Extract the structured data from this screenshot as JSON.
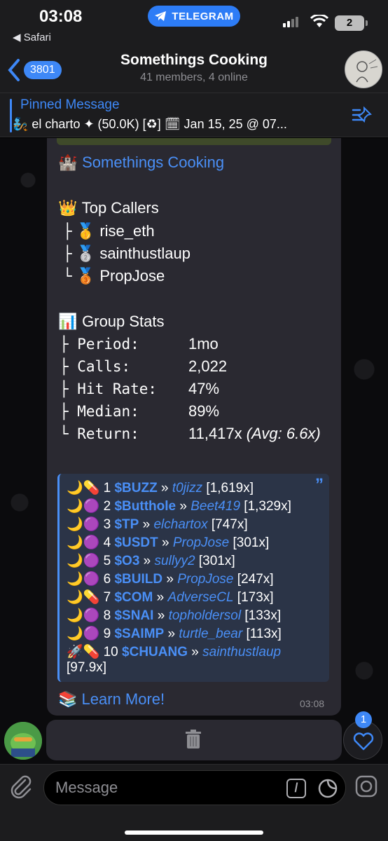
{
  "status_bar": {
    "time": "03:08",
    "back_app": "◀ Safari",
    "pill_label": "TELEGRAM",
    "battery": "2"
  },
  "header": {
    "back_count": "3801",
    "title": "Somethings Cooking",
    "subtitle": "41 members, 4 online"
  },
  "pinned": {
    "label": "Pinned Message",
    "text": "🧞 el charto ✦ (50.0K) [♻] 🗓 Jan 15, 25 @ 07..."
  },
  "message": {
    "group_title": "Somethings Cooking",
    "top_callers_title": "Top Callers",
    "top_callers": [
      {
        "branch": "├",
        "medal": "🥇",
        "name": "rise_eth"
      },
      {
        "branch": "├",
        "medal": "🥈",
        "name": "sainthustlaup"
      },
      {
        "branch": "└",
        "medal": "🥉",
        "name": "PropJose"
      }
    ],
    "stats_title": "Group Stats",
    "stats": [
      {
        "key": "├ Period:",
        "value": "1mo",
        "extra": ""
      },
      {
        "key": "├ Calls:",
        "value": "2,022",
        "extra": ""
      },
      {
        "key": "├ Hit Rate:",
        "value": "47%",
        "extra": ""
      },
      {
        "key": "├ Median:",
        "value": "89%",
        "extra": ""
      },
      {
        "key": "└ Return:",
        "value": "11,417x",
        "extra": "(Avg: 6.6x)"
      }
    ],
    "calls": [
      {
        "icons": "🌙💊",
        "rank": "1",
        "ticker": "$BUZZ",
        "sep": "»",
        "user": "t0jizz",
        "mult": "[1,619x]"
      },
      {
        "icons": "🌙🟣",
        "rank": "2",
        "ticker": "$Butthole",
        "sep": "»",
        "user": "Beet419",
        "mult": "[1,329x]"
      },
      {
        "icons": "🌙🟣",
        "rank": "3",
        "ticker": "$TP",
        "sep": "»",
        "user": "elchartox",
        "mult": "[747x]"
      },
      {
        "icons": "🌙🟣",
        "rank": "4",
        "ticker": "$USDT",
        "sep": "»",
        "user": "PropJose",
        "mult": "[301x]"
      },
      {
        "icons": "🌙🟣",
        "rank": "5",
        "ticker": "$O3",
        "sep": "»",
        "user": "sullyy2",
        "mult": "[301x]"
      },
      {
        "icons": "🌙🟣",
        "rank": "6",
        "ticker": "$BUILD",
        "sep": "»",
        "user": "PropJose",
        "mult": "[247x]"
      },
      {
        "icons": "🌙💊",
        "rank": "7",
        "ticker": "$COM",
        "sep": "»",
        "user": "AdverseCL",
        "mult": "[173x]"
      },
      {
        "icons": "🌙🟣",
        "rank": "8",
        "ticker": "$SNAI",
        "sep": "»",
        "user": "topholdersol",
        "mult": "[133x]"
      },
      {
        "icons": "🌙🟣",
        "rank": "9",
        "ticker": "$SAIMP",
        "sep": "»",
        "user": "turtle_bear",
        "mult": "[113x]"
      },
      {
        "icons": "🚀💊",
        "rank": "10",
        "ticker": "$CHUANG",
        "sep": "»",
        "user": "sainthustlaup",
        "mult": "[97.9x]"
      }
    ],
    "learn_more": "Learn More!",
    "time": "03:08"
  },
  "reactions_badge": "1",
  "input": {
    "placeholder": "Message",
    "command_glyph": "/"
  },
  "colors": {
    "accent": "#3e88f7",
    "link": "#4a8ff6",
    "bubble": "#2a2931",
    "quote_bg": "#2b3447"
  }
}
